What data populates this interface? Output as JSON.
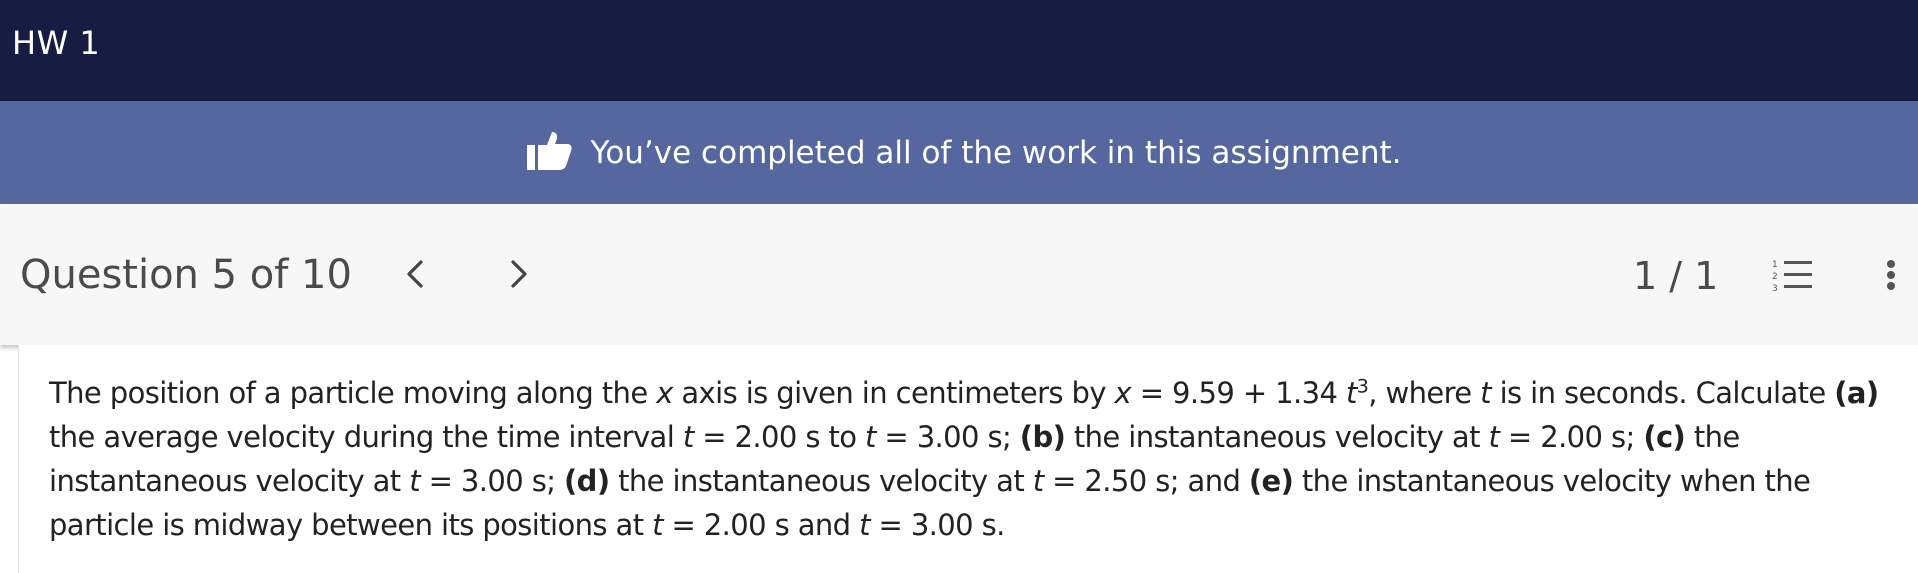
{
  "header": {
    "title": "HW 1"
  },
  "banner": {
    "icon": "thumbs-up-icon",
    "message": "You’ve completed all of the work in this assignment."
  },
  "question_bar": {
    "label": "Question 5 of 10",
    "prev_icon": "chevron-left-icon",
    "next_icon": "chevron-right-icon",
    "score": "1 / 1",
    "list_icon": "numbered-list-icon",
    "more_icon": "more-vertical-icon"
  },
  "question": {
    "parts": [
      "The position of a particle moving along the ",
      "x",
      " axis is given in centimeters by ",
      "x",
      " = 9.59 + 1.34 ",
      "t",
      "3",
      ", where ",
      "t",
      " is in seconds. Calculate ",
      "(a)",
      " the average velocity during the time interval ",
      "t",
      " = 2.00 s to ",
      "t",
      " = 3.00 s; ",
      "(b)",
      " the instantaneous velocity at ",
      "t",
      " = 2.00 s; ",
      "(c)",
      " the instantaneous velocity at ",
      "t",
      " = 3.00 s; ",
      "(d)",
      " the instantaneous velocity at ",
      "t",
      " = 2.50 s; and ",
      "(e)",
      " the instantaneous velocity when the particle is midway between its positions at ",
      "t",
      " = 2.00 s and ",
      "t",
      " = 3.00 s."
    ]
  },
  "colors": {
    "header_bg": "#171d42",
    "banner_bg": "#55679e",
    "question_bar_bg": "#f7f7f7",
    "text": "#222222"
  }
}
